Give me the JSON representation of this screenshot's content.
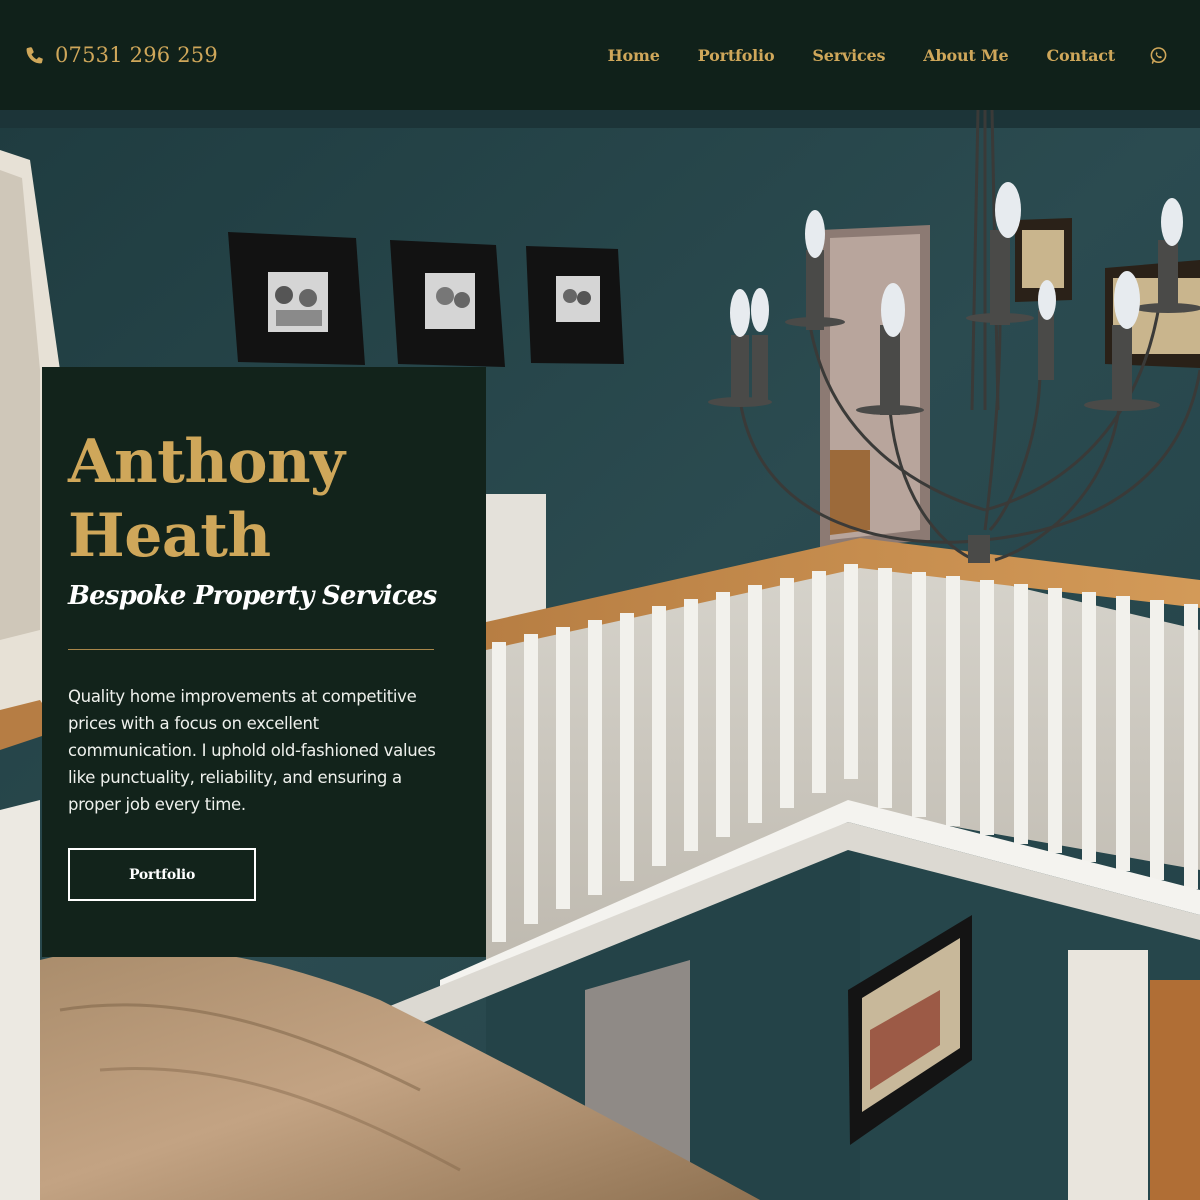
{
  "header": {
    "phone_icon": "phone-icon",
    "phone_number": "07531 296 259",
    "nav": [
      {
        "label": "Home"
      },
      {
        "label": "Portfolio"
      },
      {
        "label": "Services"
      },
      {
        "label": "About Me"
      },
      {
        "label": "Contact"
      }
    ],
    "whatsapp_icon": "whatsapp-icon"
  },
  "hero": {
    "title_line1": "Anthony",
    "title_line2": "Heath",
    "subtitle": "Bespoke Property Services",
    "description": "Quality home improvements at competitive prices with a focus on excellent communication. I uphold old-fashioned values like punctuality, reliability, and ensuring a proper job every time.",
    "button_label": "Portfolio"
  },
  "colors": {
    "background": "#12231b",
    "accent_gold": "#cfa75a",
    "wall_teal": "#294a4f",
    "text_light": "#ffffff"
  }
}
